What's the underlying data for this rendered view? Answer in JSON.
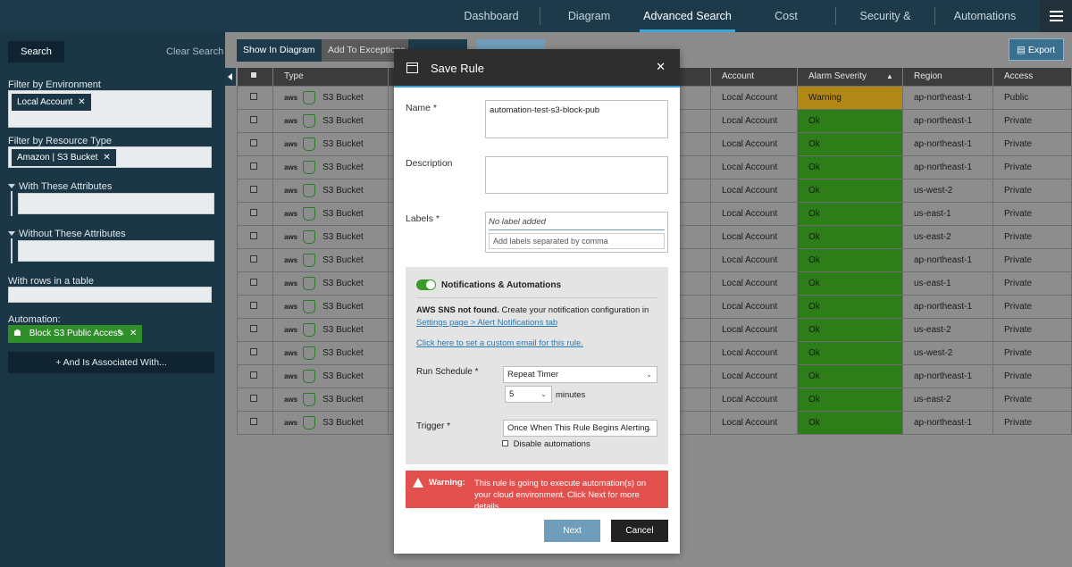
{
  "nav": {
    "items": [
      "Dashboard",
      "Diagram",
      "Advanced Search",
      "Cost",
      "Security & Compliance",
      "Automations"
    ],
    "active": "Advanced Search"
  },
  "sidebar": {
    "search_label": "Search",
    "clear_label": "Clear Search",
    "filter_env_label": "Filter by Environment",
    "env_tag": "Local Account",
    "filter_type_label": "Filter by Resource Type",
    "type_tag": "Amazon | S3 Bucket",
    "with_attrs_label": "With These Attributes",
    "without_attrs_label": "Without These Attributes",
    "rows_label": "With rows in a table",
    "automation_label": "Automation:",
    "automation_tag": "Block S3 Public Access",
    "assoc_label": "+ And Is Associated With..."
  },
  "toolbar": {
    "show_diagram": "Show In Diagram",
    "add_exceptions": "Add To Exceptions",
    "export": "Export"
  },
  "table": {
    "headers": {
      "type": "Type",
      "account": "Account",
      "severity": "Alarm Severity",
      "region": "Region",
      "access": "Access"
    },
    "rows": [
      {
        "type": "S3 Bucket",
        "account": "Local Account",
        "severity": "Warning",
        "region": "ap-northeast-1",
        "access": "Public"
      },
      {
        "type": "S3 Bucket",
        "account": "Local Account",
        "severity": "Ok",
        "region": "ap-northeast-1",
        "access": "Private"
      },
      {
        "type": "S3 Bucket",
        "account": "Local Account",
        "severity": "Ok",
        "region": "ap-northeast-1",
        "access": "Private"
      },
      {
        "type": "S3 Bucket",
        "account": "Local Account",
        "severity": "Ok",
        "region": "ap-northeast-1",
        "access": "Private"
      },
      {
        "type": "S3 Bucket",
        "account": "Local Account",
        "severity": "Ok",
        "region": "us-west-2",
        "access": "Private"
      },
      {
        "type": "S3 Bucket",
        "account": "Local Account",
        "severity": "Ok",
        "region": "us-east-1",
        "access": "Private"
      },
      {
        "type": "S3 Bucket",
        "account": "Local Account",
        "severity": "Ok",
        "region": "us-east-2",
        "access": "Private"
      },
      {
        "type": "S3 Bucket",
        "account": "Local Account",
        "severity": "Ok",
        "region": "ap-northeast-1",
        "access": "Private"
      },
      {
        "type": "S3 Bucket",
        "account": "Local Account",
        "severity": "Ok",
        "region": "us-east-1",
        "access": "Private"
      },
      {
        "type": "S3 Bucket",
        "account": "Local Account",
        "severity": "Ok",
        "region": "ap-northeast-1",
        "access": "Private"
      },
      {
        "type": "S3 Bucket",
        "account": "Local Account",
        "severity": "Ok",
        "region": "us-east-2",
        "access": "Private"
      },
      {
        "type": "S3 Bucket",
        "account": "Local Account",
        "severity": "Ok",
        "region": "us-west-2",
        "access": "Private"
      },
      {
        "type": "S3 Bucket",
        "account": "Local Account",
        "severity": "Ok",
        "region": "ap-northeast-1",
        "access": "Private"
      },
      {
        "type": "S3 Bucket",
        "account": "Local Account",
        "severity": "Ok",
        "region": "us-east-2",
        "access": "Private"
      },
      {
        "type": "S3 Bucket",
        "account": "Local Account",
        "severity": "Ok",
        "region": "ap-northeast-1",
        "access": "Private"
      }
    ]
  },
  "modal": {
    "title": "Save Rule",
    "name_label": "Name *",
    "name_value": "automation-test-s3-block-pub",
    "description_label": "Description",
    "labels_label": "Labels *",
    "no_label": "No label added",
    "labels_placeholder": "Add labels separated by comma",
    "notif_title": "Notifications & Automations",
    "sns_bold": "AWS SNS not found.",
    "sns_text": " Create your notification configuration in",
    "settings_link": "Settings page > Alert Notifications tab",
    "custom_email_link": "Click here to set a custom email for this rule.",
    "run_schedule_label": "Run Schedule *",
    "schedule_value": "Repeat Timer",
    "minutes_value": "5",
    "minutes_label": "minutes",
    "trigger_label": "Trigger *",
    "trigger_value": "Once When This Rule Begins Alerting",
    "disable_label": "Disable automations",
    "warning_label": "Warning:",
    "warning_text": "This rule is going to execute automation(s) on your cloud environment. Click Next for more details.",
    "next_label": "Next",
    "cancel_label": "Cancel"
  },
  "colors": {
    "ok": "#2d7d19",
    "warning": "#b18716",
    "accent": "#3ea6d6",
    "danger": "#e3514f"
  }
}
